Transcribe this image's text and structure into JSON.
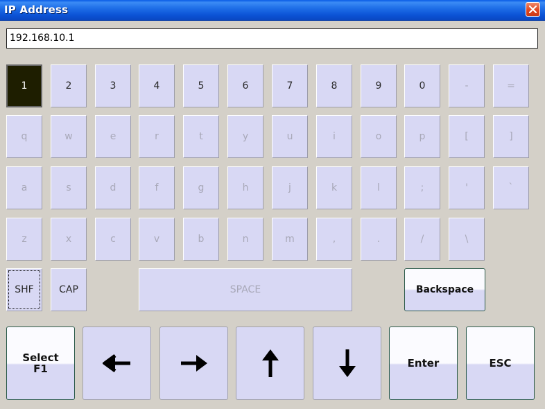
{
  "window": {
    "title": "IP Address"
  },
  "ip_field": {
    "value": "192.168.10.1"
  },
  "keys": {
    "row1": [
      "1",
      "2",
      "3",
      "4",
      "5",
      "6",
      "7",
      "8",
      "9",
      "0",
      "-",
      "="
    ],
    "row2": [
      "q",
      "w",
      "e",
      "r",
      "t",
      "y",
      "u",
      "i",
      "o",
      "p",
      "[",
      "]"
    ],
    "row3": [
      "a",
      "s",
      "d",
      "f",
      "g",
      "h",
      "j",
      "k",
      "l",
      ";",
      "'",
      "`"
    ],
    "row4": [
      "z",
      "x",
      "c",
      "v",
      "b",
      "n",
      "m",
      ",",
      ".",
      "/",
      "\\"
    ],
    "shift": "SHF",
    "caps": "CAP",
    "space": "SPACE",
    "backspace": "Backspace"
  },
  "bottom": {
    "select": "Select\nF1",
    "enter": "Enter",
    "esc": "ESC"
  },
  "colors": {
    "title_bar": "#1f6fe8",
    "key_face": "#d8d8f4",
    "pressed_key": "#1e1e00",
    "close_button": "#e0461f"
  }
}
